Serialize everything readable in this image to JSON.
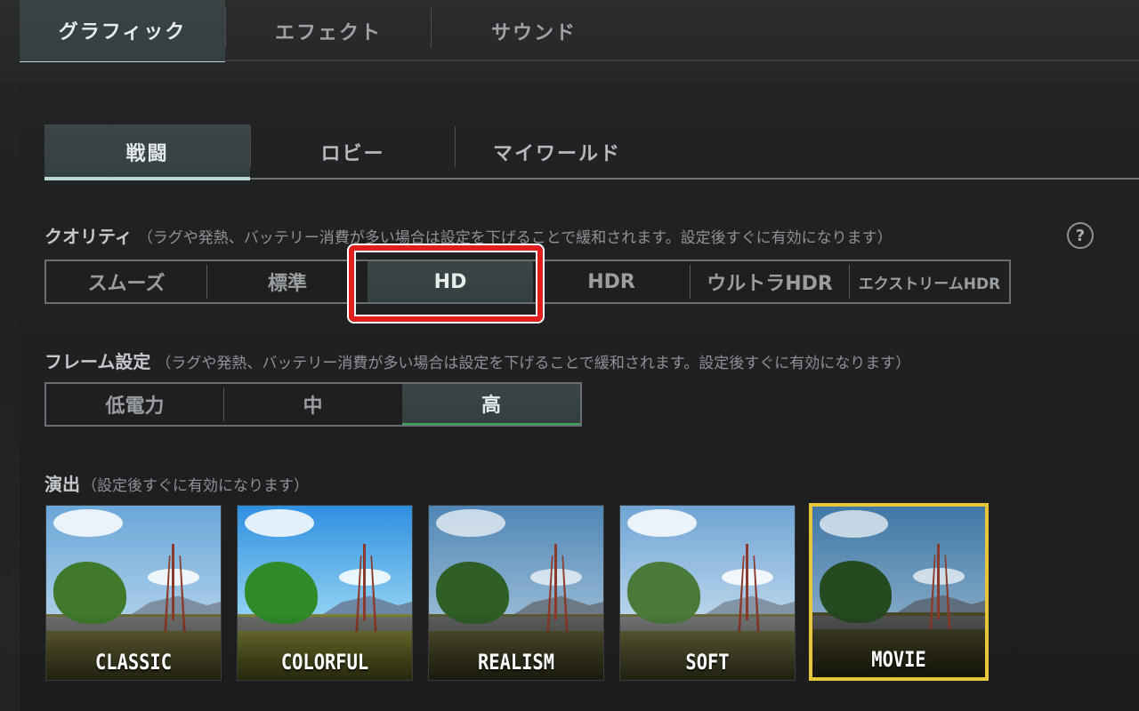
{
  "top_tabs": [
    {
      "label": "グラフィック",
      "active": true
    },
    {
      "label": "エフェクト",
      "active": false
    },
    {
      "label": "サウンド",
      "active": false
    }
  ],
  "sub_tabs": [
    {
      "label": "戦闘",
      "active": true
    },
    {
      "label": "ロビー",
      "active": false
    },
    {
      "label": "マイワールド",
      "active": false
    }
  ],
  "quality": {
    "title": "クオリティ",
    "note": "（ラグや発熱、バッテリー消費が多い場合は設定を下げることで緩和されます。設定後すぐに有効になります）",
    "help_icon": "help-icon",
    "options": [
      "スムーズ",
      "標準",
      "HD",
      "HDR",
      "ウルトラHDR",
      "エクストリームHDR"
    ],
    "selected": "HD"
  },
  "frame": {
    "title": "フレーム設定",
    "note": "（ラグや発熱、バッテリー消費が多い場合は設定を下げることで緩和されます。設定後すぐに有効になります）",
    "options": [
      "低電力",
      "中",
      "高"
    ],
    "selected": "高"
  },
  "style": {
    "title": "演出",
    "note": "（設定後すぐに有効になります）",
    "options": [
      "CLASSIC",
      "COLORFUL",
      "REALISM",
      "SOFT",
      "MOVIE"
    ],
    "selected": "MOVIE"
  },
  "colors": {
    "accent": "#b9d8d3",
    "highlight_box": "#e11d1d",
    "selected_style_border": "#e8c63a"
  }
}
